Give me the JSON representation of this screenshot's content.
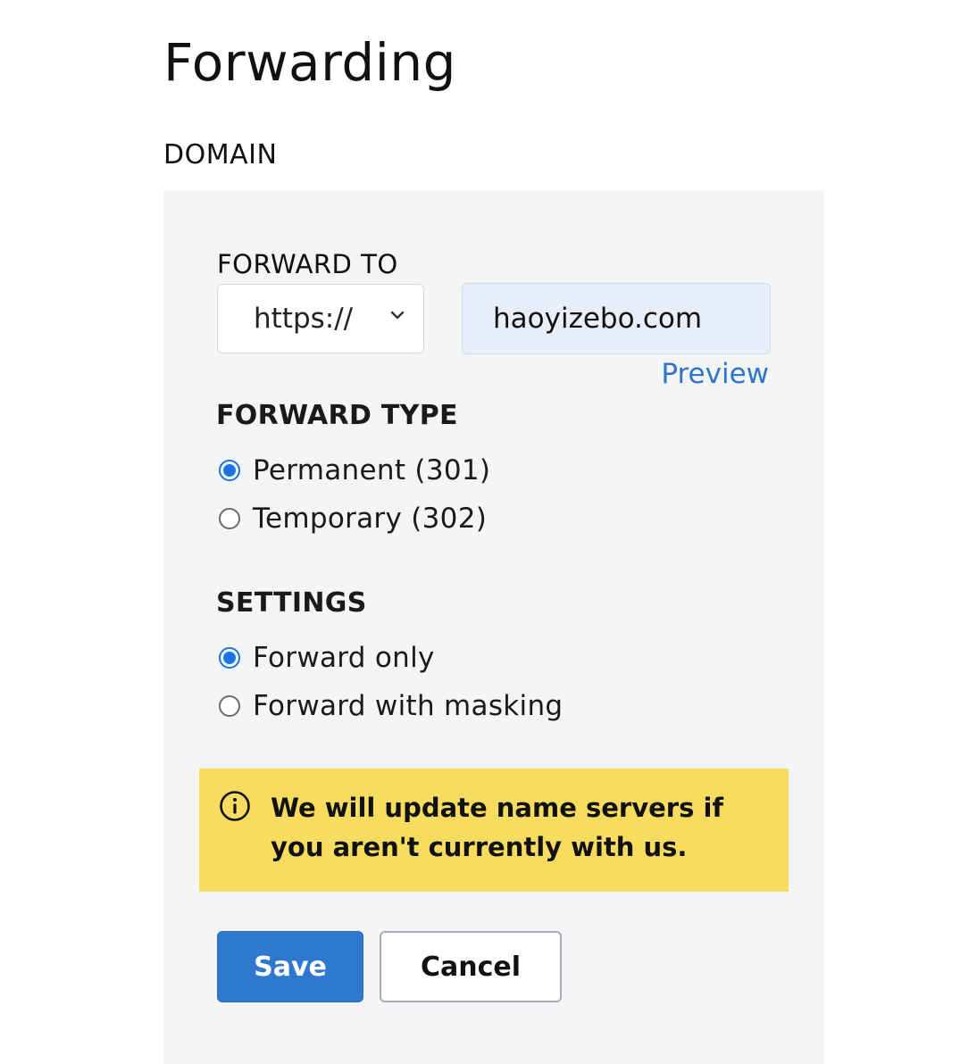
{
  "page": {
    "title": "Forwarding",
    "section_label": "DOMAIN"
  },
  "forward_to": {
    "label": "FORWARD TO",
    "protocol_selected": "https://",
    "url_value": "haoyizebo.com",
    "preview_label": "Preview"
  },
  "forward_type": {
    "heading": "FORWARD TYPE",
    "options": [
      {
        "label": "Permanent (301)",
        "checked": true
      },
      {
        "label": "Temporary (302)",
        "checked": false
      }
    ]
  },
  "settings": {
    "heading": "SETTINGS",
    "options": [
      {
        "label": "Forward only",
        "checked": true
      },
      {
        "label": "Forward with masking",
        "checked": false
      }
    ]
  },
  "notice": {
    "icon": "info-icon",
    "text": "We will update name servers if you aren't currently with us."
  },
  "actions": {
    "save_label": "Save",
    "cancel_label": "Cancel"
  },
  "colors": {
    "accent": "#2f78cf",
    "link": "#2f75cb",
    "notice_bg": "#f7dc60",
    "panel_bg": "#f4f5f7",
    "input_bg": "#e8eefb"
  }
}
